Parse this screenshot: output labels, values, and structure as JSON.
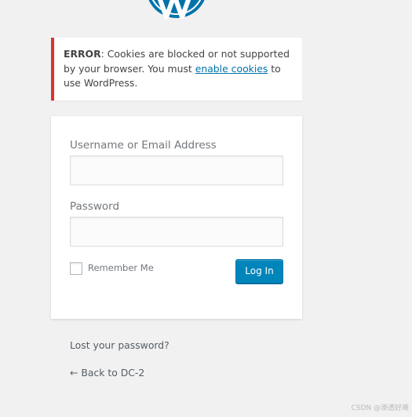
{
  "error": {
    "prefix": "ERROR",
    "text_before_link": ": Cookies are blocked or not supported by your browser. You must ",
    "link_text": "enable cookies",
    "text_after_link": " to use WordPress."
  },
  "form": {
    "username_label": "Username or Email Address",
    "username_value": "",
    "password_label": "Password",
    "password_value": "",
    "remember_label": "Remember Me",
    "remember_checked": false,
    "login_button": "Log In"
  },
  "links": {
    "lost_password": "Lost your password?",
    "back_to_site": "← Back to DC-2"
  },
  "watermark": "CSDN @渗透好难",
  "colors": {
    "background": "#f1f1f1",
    "error_border": "#dc3232",
    "link": "#0073aa",
    "button": "#0085ba",
    "logo": "#0073aa"
  },
  "icons": {
    "logo": "wordpress-logo-icon"
  }
}
